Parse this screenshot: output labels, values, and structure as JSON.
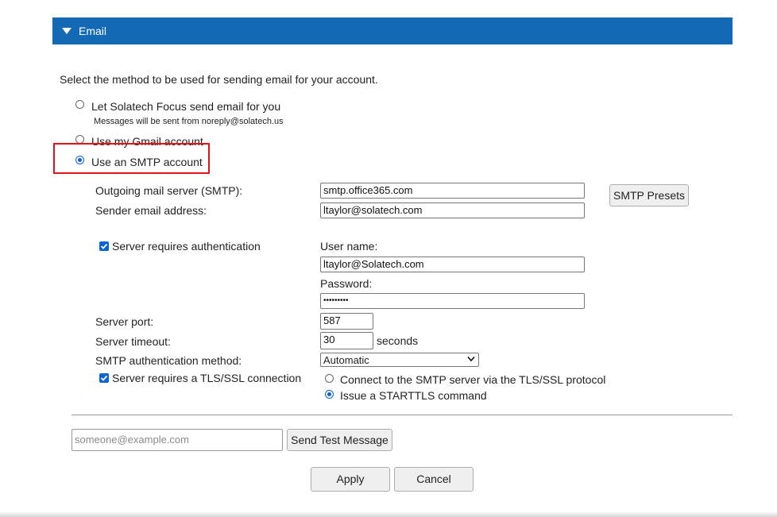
{
  "section": {
    "title": "Email"
  },
  "intro": "Select the method to be used for sending email for your account.",
  "methods": [
    {
      "label": "Let Solatech Focus send email for you",
      "note": "Messages will be sent from noreply@solatech.us",
      "selected": false
    },
    {
      "label": "Use my Gmail account",
      "selected": false
    },
    {
      "label": "Use an SMTP account",
      "selected": true
    }
  ],
  "smtp": {
    "server_label": "Outgoing mail server (SMTP):",
    "server_value": "smtp.office365.com",
    "presets_button": "SMTP Presets",
    "sender_label": "Sender email address:",
    "sender_value": "ltaylor@solatech.com",
    "auth_label": "Server requires authentication",
    "auth_checked": true,
    "username_label": "User name:",
    "username_value": "ltaylor@Solatech.com",
    "password_label": "Password:",
    "password_value": "•••••••••",
    "port_label": "Server port:",
    "port_value": "587",
    "timeout_label": "Server timeout:",
    "timeout_value": "30",
    "timeout_unit": "seconds",
    "auth_method_label": "SMTP authentication method:",
    "auth_method_value": "Automatic",
    "tls_label": "Server requires a TLS/SSL connection",
    "tls_checked": true,
    "tls_options": [
      {
        "label": "Connect to the SMTP server via the TLS/SSL protocol",
        "selected": false
      },
      {
        "label": "Issue a STARTTLS command",
        "selected": true
      }
    ]
  },
  "test": {
    "placeholder": "someone@example.com",
    "button": "Send Test Message"
  },
  "actions": {
    "apply": "Apply",
    "cancel": "Cancel"
  },
  "colors": {
    "header_bg": "#1469b4",
    "highlight_border": "#e0131b",
    "accent": "#0a64d7"
  }
}
